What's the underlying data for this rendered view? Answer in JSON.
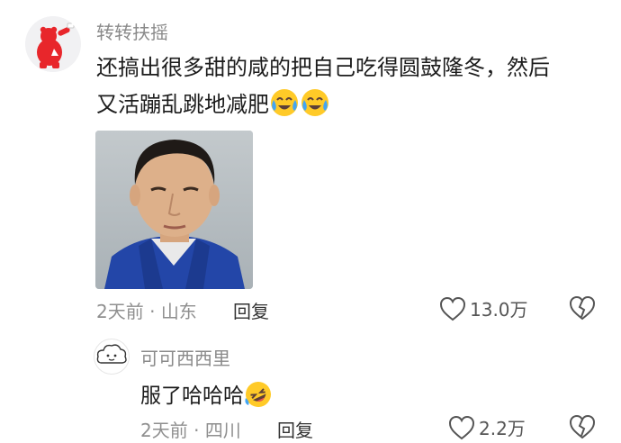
{
  "comment": {
    "username": "转转扶摇",
    "text_line1": "还搞出很多甜的咸的把自己吃得圆鼓隆冬，然后",
    "text_line2": "又活蹦乱跳地减肥",
    "emoji_line2": [
      "crying-laughing-emoji",
      "crying-laughing-emoji"
    ],
    "time": "2天前",
    "separator": "·",
    "location": "山东",
    "reply_label": "回复",
    "like_count": "13.0万"
  },
  "reply": {
    "username": "可可西西里",
    "text": "服了哈哈哈",
    "emoji": "rolling-laughing-emoji",
    "time": "2天前",
    "separator": "·",
    "location": "四川",
    "reply_label": "回复",
    "like_count": "2.2万"
  },
  "colors": {
    "muted": "#8f8f8f",
    "text": "#1c1c1c",
    "emoji_face": "#ffca28",
    "emoji_tear": "#42a5f5"
  }
}
